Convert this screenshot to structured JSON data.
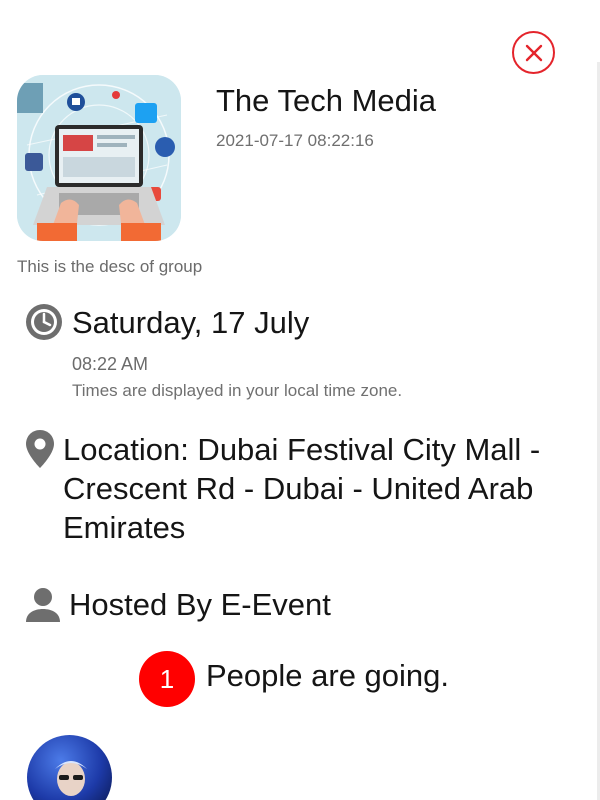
{
  "header": {
    "close_icon": "close-circle-icon",
    "accent_color": "#e4242b"
  },
  "group": {
    "title": "The Tech Media",
    "timestamp": "2021-07-17 08:22:16",
    "description": "This is the desc of group",
    "image": "tech-media-laptop-illustration"
  },
  "event": {
    "date_icon": "clock-icon",
    "date": "Saturday, 17 July",
    "time": "08:22 AM",
    "timezone_note": "Times are displayed in your local time zone.",
    "location_icon": "location-pin-icon",
    "location": "Location: Dubai Festival City Mall - Crescent Rd - Dubai - United Arab Emirates",
    "host_icon": "person-icon",
    "host": "Hosted By E-Event"
  },
  "attendance": {
    "count": "1",
    "label": "People are going.",
    "badge_color": "#ff0000"
  },
  "attendees": [
    {
      "avatar": "attendee-avatar-photo"
    }
  ]
}
